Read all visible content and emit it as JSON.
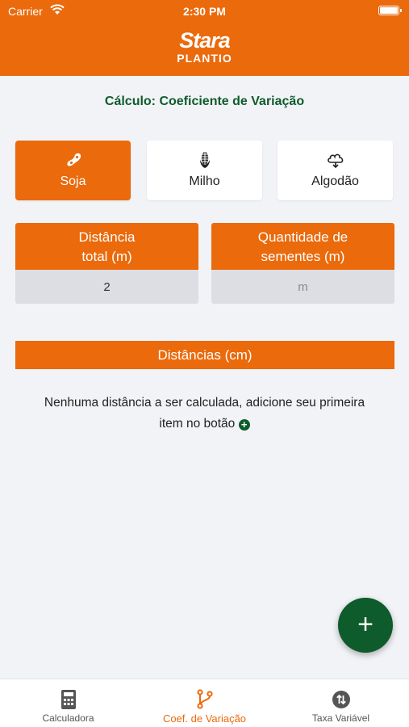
{
  "status_bar": {
    "carrier": "Carrier",
    "time": "2:30 PM"
  },
  "brand": {
    "logo_text": "Stara",
    "subtitle": "PLANTIO"
  },
  "title": "Cálculo: Coeficiente de Variação",
  "crops": {
    "items": [
      {
        "label": "Soja",
        "icon": "soybean-icon",
        "selected": true
      },
      {
        "label": "Milho",
        "icon": "corn-icon",
        "selected": false
      },
      {
        "label": "Algodão",
        "icon": "cotton-icon",
        "selected": false
      }
    ]
  },
  "inputs": {
    "total_distance": {
      "label_line1": "Distância",
      "label_line2": "total (m)",
      "value": "2",
      "placeholder": ""
    },
    "seed_quantity": {
      "label_line1": "Quantidade de",
      "label_line2": "sementes (m)",
      "value": "",
      "placeholder": "m"
    }
  },
  "distances": {
    "header": "Distâncias (cm)",
    "empty_line1": "Nenhuma distância a ser calculada, adicione seu primeira",
    "empty_line2": "item no botão"
  },
  "fab": {
    "label": "+"
  },
  "tabs": [
    {
      "label": "Calculadora",
      "icon": "calculator-icon",
      "active": false
    },
    {
      "label": "Coef. de Variação",
      "icon": "branch-icon",
      "active": true
    },
    {
      "label": "Taxa Variável",
      "icon": "swap-icon",
      "active": false
    }
  ],
  "colors": {
    "primary": "#ea6a0c",
    "accent_green": "#0e5b2c",
    "background": "#f2f3f7"
  }
}
